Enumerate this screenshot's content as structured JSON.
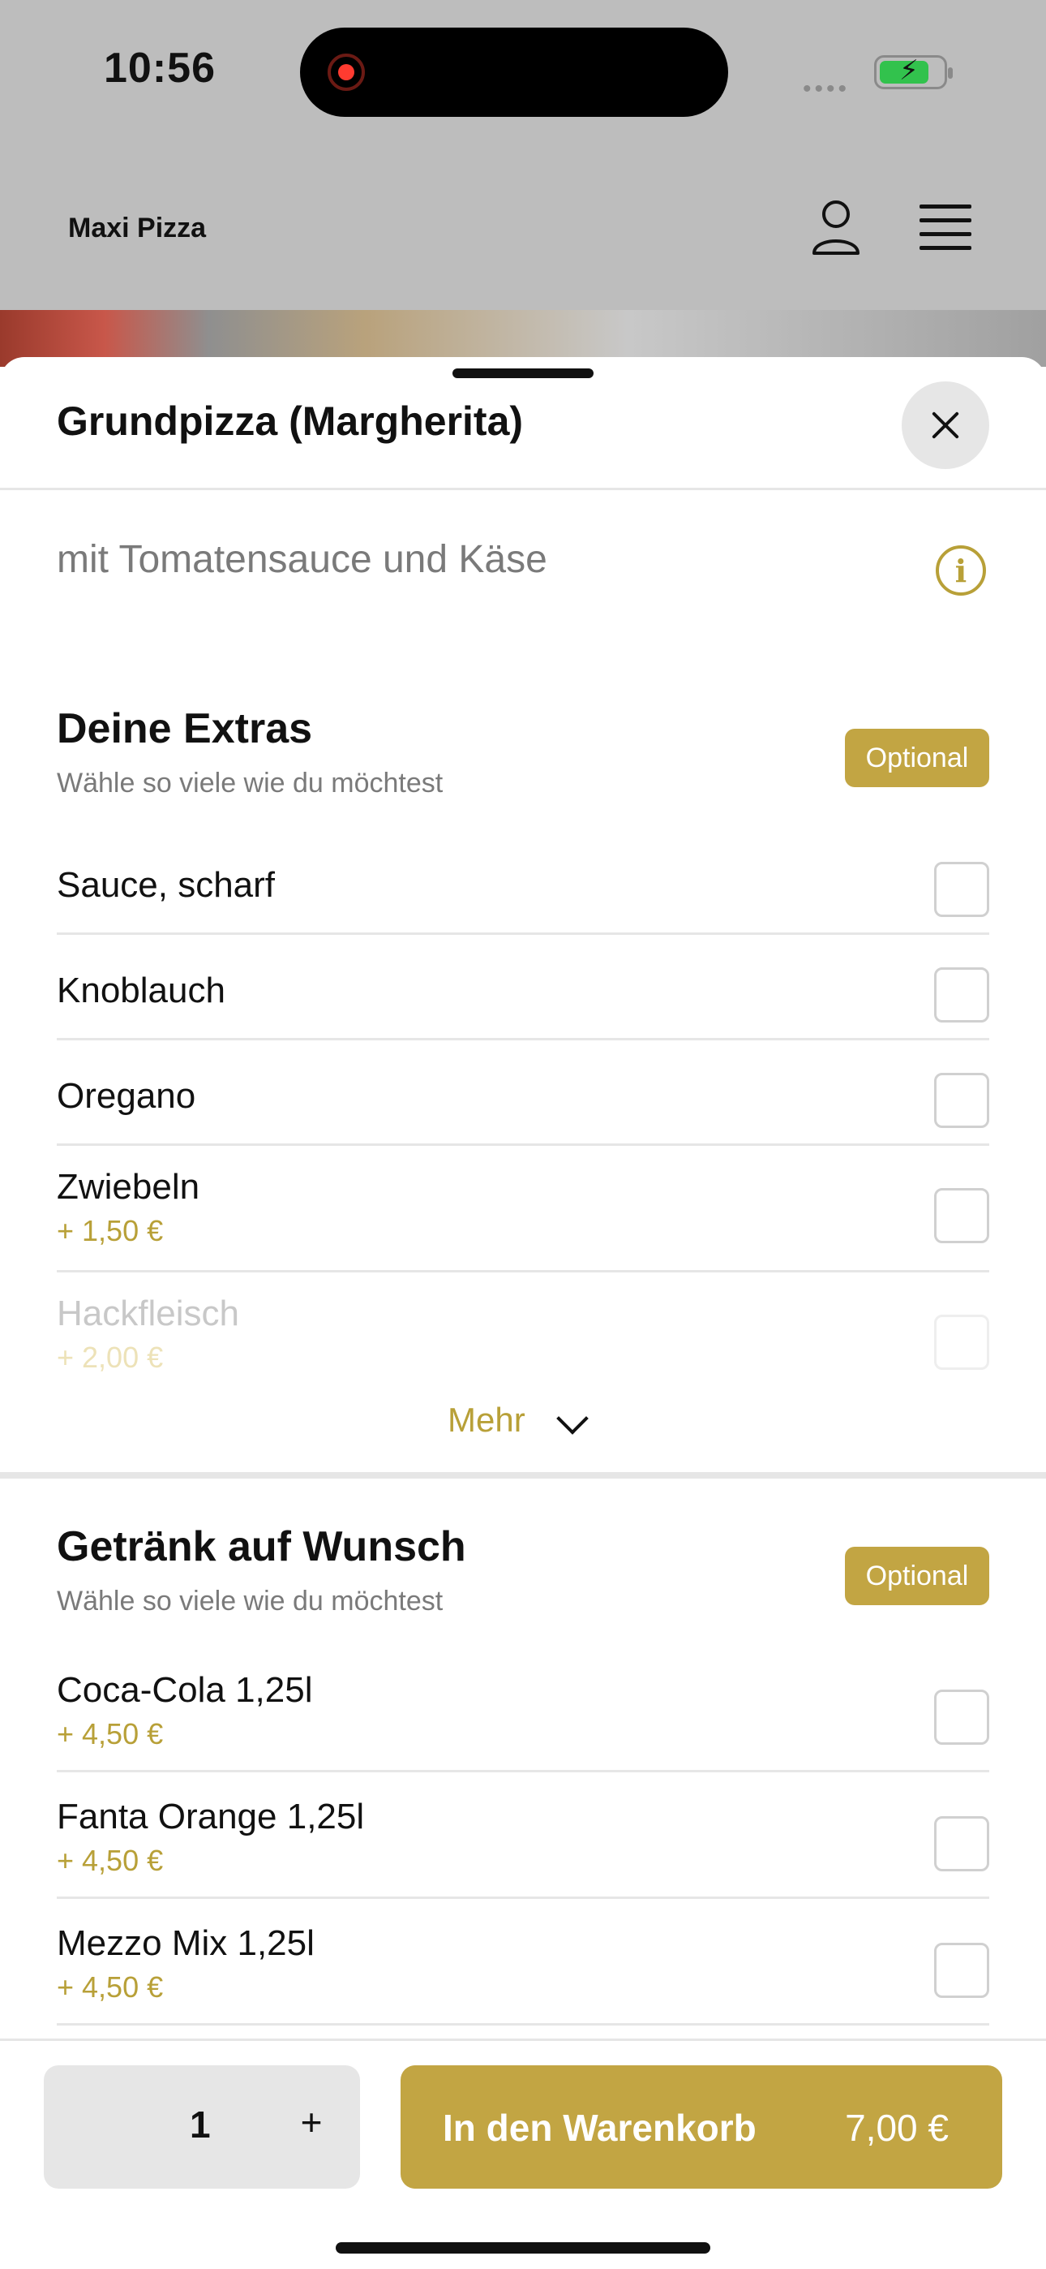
{
  "status_bar": {
    "time": "10:56",
    "signal": "••••"
  },
  "app": {
    "title": "Maxi Pizza"
  },
  "sheet": {
    "title": "Grundpizza (Margherita)",
    "description": "mit Tomatensauce und Käse",
    "info_icon_glyph": "i"
  },
  "extras": {
    "title": "Deine Extras",
    "subtitle": "Wähle so viele wie du möchtest",
    "badge": "Optional",
    "items": [
      {
        "name": "Sauce, scharf",
        "price": ""
      },
      {
        "name": "Knoblauch",
        "price": ""
      },
      {
        "name": "Oregano",
        "price": ""
      },
      {
        "name": "Zwiebeln",
        "price": "+ 1,50 €"
      },
      {
        "name": "Hackfleisch",
        "price": "+ 2,00 €"
      }
    ],
    "more_label": "Mehr"
  },
  "drinks": {
    "title": "Getränk auf Wunsch",
    "subtitle": "Wähle so viele wie du möchtest",
    "badge": "Optional",
    "items": [
      {
        "name": "Coca-Cola 1,25l",
        "price": "+ 4,50 €"
      },
      {
        "name": "Fanta Orange 1,25l",
        "price": "+ 4,50 €"
      },
      {
        "name": "Mezzo Mix 1,25l",
        "price": "+ 4,50 €"
      }
    ]
  },
  "bottom": {
    "quantity": "1",
    "plus_label": "+",
    "cart_label": "In den Warenkorb",
    "cart_price": "7,00 €"
  },
  "colors": {
    "accent": "#c2a543",
    "accent_text": "#b8a038",
    "overlay": "#bdbdbd"
  },
  "icons": [
    "user-icon",
    "menu-icon",
    "close-icon",
    "info-icon",
    "chevron-down-icon",
    "battery-icon"
  ]
}
